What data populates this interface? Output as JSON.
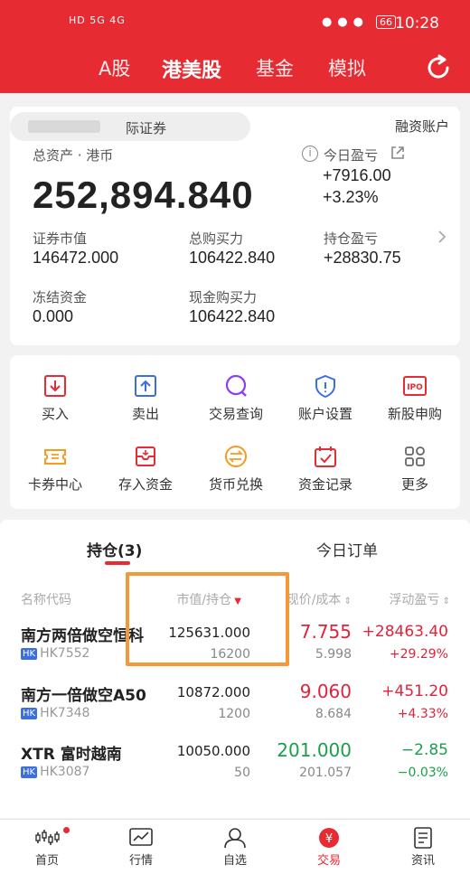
{
  "status_bar": {
    "left": "HD 5G 4G",
    "time": "10:28",
    "battery": "66"
  },
  "tabs": [
    "A股",
    "港美股",
    "基金",
    "模拟"
  ],
  "active_tab": "港美股",
  "account": {
    "name_suffix": "际证券",
    "margin_account": "融资账户",
    "total_assets_label": "总资产 · 港币",
    "total_assets": "252,894.840",
    "today_pl_label": "今日盈亏",
    "today_pl": "+7916.00",
    "today_pl_pct": "+3.23%",
    "metrics": [
      {
        "label": "证券市值",
        "value": "146472.000"
      },
      {
        "label": "总购买力",
        "value": "106422.840"
      },
      {
        "label": "持仓盈亏",
        "value": "+28830.75"
      },
      {
        "label": "冻结资金",
        "value": "0.000"
      },
      {
        "label": "现金购买力",
        "value": "106422.840"
      }
    ]
  },
  "functions": [
    {
      "label": "买入",
      "icon": "buy-icon"
    },
    {
      "label": "卖出",
      "icon": "sell-icon"
    },
    {
      "label": "交易查询",
      "icon": "trade-query-icon"
    },
    {
      "label": "账户设置",
      "icon": "account-settings-icon"
    },
    {
      "label": "新股申购",
      "icon": "ipo-icon"
    },
    {
      "label": "卡券中心",
      "icon": "coupon-icon"
    },
    {
      "label": "存入资金",
      "icon": "deposit-icon"
    },
    {
      "label": "货币兑换",
      "icon": "currency-exchange-icon"
    },
    {
      "label": "资金记录",
      "icon": "fund-record-icon"
    },
    {
      "label": "更多",
      "icon": "more-icon"
    }
  ],
  "holdings": {
    "tab_positions": "持仓(3)",
    "tab_orders": "今日订单",
    "columns": [
      "名称代码",
      "市值/持仓",
      "现价/成本",
      "浮动盈亏"
    ],
    "rows": [
      {
        "name": "南方两倍做空恒科",
        "code": "HK7552",
        "market_value": "125631.000",
        "quantity": "16200",
        "price": "7.755",
        "cost": "5.998",
        "pl": "+28463.40",
        "pl_pct": "+29.29%",
        "trend": "up"
      },
      {
        "name": "南方一倍做空A50",
        "code": "HK7348",
        "market_value": "10872.000",
        "quantity": "1200",
        "price": "9.060",
        "cost": "8.684",
        "pl": "+451.20",
        "pl_pct": "+4.33%",
        "trend": "up"
      },
      {
        "name": "XTR 富时越南",
        "code": "HK3087",
        "market_value": "10050.000",
        "quantity": "50",
        "price": "201.000",
        "cost": "201.057",
        "pl": "−2.85",
        "pl_pct": "−0.03%",
        "trend": "down"
      }
    ]
  },
  "nav": [
    {
      "label": "首页",
      "icon": "home-icon"
    },
    {
      "label": "行情",
      "icon": "market-icon"
    },
    {
      "label": "自选",
      "icon": "watchlist-icon"
    },
    {
      "label": "交易",
      "icon": "trade-icon"
    },
    {
      "label": "资讯",
      "icon": "news-icon"
    }
  ],
  "colors": {
    "brand": "#e72b33",
    "up": "#e0233b",
    "down": "#1a9f4c",
    "highlight": "#f4993b"
  }
}
